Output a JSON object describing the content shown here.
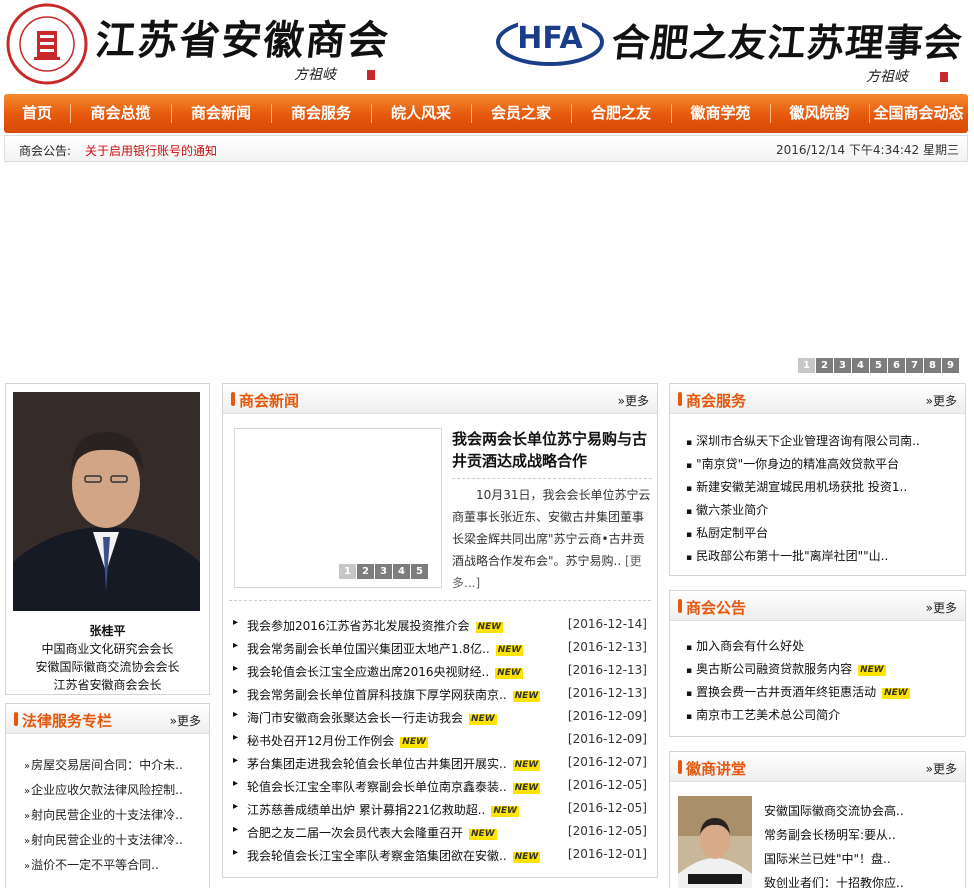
{
  "header": {
    "title_left": "江苏省安徽商会",
    "signature_left": "方祖岐",
    "logo_left_icon": "chamber-seal-logo-icon",
    "logo_right_text": "HFA",
    "title_right": "合肥之友江苏理事会",
    "signature_right": "方祖岐"
  },
  "nav": [
    {
      "label": "首页",
      "width": 66
    },
    {
      "label": "商会总揽",
      "width": 101
    },
    {
      "label": "商会新闻",
      "width": 100
    },
    {
      "label": "商会服务",
      "width": 100
    },
    {
      "label": "皖人风采",
      "width": 100
    },
    {
      "label": "会员之家",
      "width": 100
    },
    {
      "label": "合肥之友",
      "width": 100
    },
    {
      "label": "徽商学苑",
      "width": 99
    },
    {
      "label": "徽风皖韵",
      "width": 99
    },
    {
      "label": "全国商会动态",
      "width": 99
    }
  ],
  "notice": {
    "label": "商会公告:",
    "text": "关于启用银行账号的通知",
    "datetime": "2016/12/14 下午4:34:42 星期三"
  },
  "banner_pages": [
    "1",
    "2",
    "3",
    "4",
    "5",
    "6",
    "7",
    "8",
    "9"
  ],
  "profile": {
    "name": "张桂平",
    "lines": [
      "中国商业文化研究会会长",
      "安徽国际徽商交流协会会长",
      "江苏省安徽商会会长"
    ]
  },
  "legal": {
    "title": "法律服务专栏",
    "more": "更多",
    "items": [
      "房屋交易居间合同：中介未..",
      "企业应收欠款法律风险控制..",
      "射向民营企业的十支法律冷..",
      "射向民营企业的十支法律冷..",
      "溢价不一定不平等合同.."
    ]
  },
  "news": {
    "title": "商会新闻",
    "more": "更多",
    "feature_title": "我会两会长单位苏宁易购与古井贡酒达成战略合作",
    "feature_body": "10月31日，我会会长单位苏宁云商董事长张近东、安徽古井集团董事长梁金辉共同出席\"苏宁云商•古井贡酒战略合作发布会\"。苏宁易购..",
    "feature_more": "[更多...]",
    "feature_pages": [
      "1",
      "2",
      "3",
      "4",
      "5"
    ],
    "items": [
      {
        "title": "我会参加2016江苏省苏北发展投资推介会",
        "date": "[2016-12-14]",
        "new": "NEW"
      },
      {
        "title": "我会常务副会长单位国兴集团亚太地产1.8亿..",
        "date": "[2016-12-13]",
        "new": "NEW"
      },
      {
        "title": "我会轮值会长江宝全应邀出席2016央视财经..",
        "date": "[2016-12-13]",
        "new": "NEW"
      },
      {
        "title": "我会常务副会长单位首屏科技旗下厚学网获南京..",
        "date": "[2016-12-13]",
        "new": "NEW"
      },
      {
        "title": "海门市安徽商会张聚达会长一行走访我会",
        "date": "[2016-12-09]",
        "new": "NEW"
      },
      {
        "title": "秘书处召开12月份工作例会",
        "date": "[2016-12-09]",
        "new": "NEW"
      },
      {
        "title": "茅台集团走进我会轮值会长单位古井集团开展实..",
        "date": "[2016-12-07]",
        "new": "NEW"
      },
      {
        "title": "轮值会长江宝全率队考察副会长单位南京鑫泰装..",
        "date": "[2016-12-05]",
        "new": "NEW"
      },
      {
        "title": "江苏慈善成绩单出炉 累计募捐221亿救助超..",
        "date": "[2016-12-05]",
        "new": "NEW"
      },
      {
        "title": "合肥之友二届一次会员代表大会隆重召开",
        "date": "[2016-12-05]",
        "new": "NEW"
      },
      {
        "title": "我会轮值会长江宝全率队考察金箔集团欲在安徽..",
        "date": "[2016-12-01]",
        "new": "NEW"
      }
    ]
  },
  "service": {
    "title": "商会服务",
    "more": "更多",
    "items": [
      "深圳市合纵天下企业管理咨询有限公司南..",
      "\"南京贷\"一你身边的精准高效贷款平台",
      "新建安徽芜湖宣城民用机场获批 投资1..",
      "徽六茶业简介",
      "私厨定制平台",
      "民政部公布第十一批\"离岸社团\"\"山.."
    ]
  },
  "announce": {
    "title": "商会公告",
    "more": "更多",
    "items": [
      {
        "title": "加入商会有什么好处",
        "new": ""
      },
      {
        "title": "奥古斯公司融资贷款服务内容",
        "new": "NEW"
      },
      {
        "title": "置换会费一古井贡酒年终钜惠活动",
        "new": "NEW"
      },
      {
        "title": "南京市工艺美术总公司简介",
        "new": ""
      }
    ]
  },
  "lecture": {
    "title": "徽商讲堂",
    "more": "更多",
    "items": [
      "安徽国际徽商交流协会高..",
      "常务副会长杨明军:要从..",
      "国际米兰已姓\"中\"！盘..",
      "致创业者们：十招教你应.."
    ]
  },
  "colors": {
    "accent": "#e5580d",
    "notice_red": "#c8100e",
    "new_badge": "#ffe400"
  }
}
